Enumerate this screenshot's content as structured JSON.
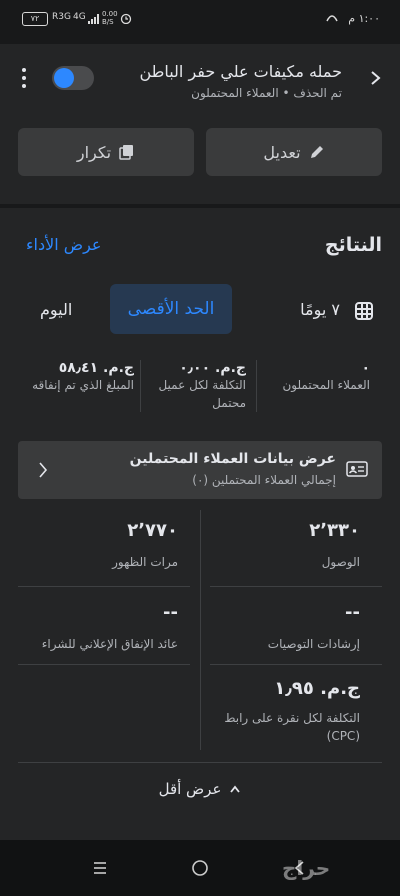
{
  "status_bar": {
    "time": "١:٠٠",
    "am_pm": "م",
    "battery": "٧٢",
    "network": "4G",
    "speed": "0.00 B/S"
  },
  "campaign": {
    "title": "حمله مكيفات علي حفر الباطن",
    "subtitle": "تم الحذف • العملاء المحتملون"
  },
  "actions": {
    "edit_label": "تعديل",
    "duplicate_label": "تكرار"
  },
  "results": {
    "title": "النتائج",
    "view_performance": "عرض الأداء",
    "tabs": [
      "اليوم",
      "الحد الأقصى",
      "٧ يومًا"
    ],
    "active_tab": 1
  },
  "summary": [
    {
      "value": "٠",
      "label": "العملاء المحتملون"
    },
    {
      "value": "ج.م. ٠٫٠٠",
      "label": "التكلفة لكل عميل محتمل"
    },
    {
      "value": "ج.م. ٥٨٫٤١",
      "label": "المبلغ الذي تم إنفاقه"
    }
  ],
  "leads_card": {
    "title": "عرض بيانات العملاء المحتملين",
    "subtitle": "إجمالي العملاء المحتملين (٠)"
  },
  "metrics": [
    {
      "value": "٢٬٣٣٠",
      "label": "الوصول"
    },
    {
      "value": "٢٬٧٧٠",
      "label": "مرات الظهور"
    },
    {
      "value": "--",
      "label": "إرشادات التوصيات"
    },
    {
      "value": "--",
      "label": "عائد الإنفاق الإعلاني للشراء"
    },
    {
      "value": "ج.م. ١٫٩٥",
      "label": "التكلفة لكل نقرة على رابط (CPC)"
    }
  ],
  "show_less": "عرض أقل",
  "watermark": "حراج",
  "colors": {
    "accent": "#2d88ff",
    "background": "#18191a",
    "card": "#242526",
    "button": "#3a3b3c"
  }
}
